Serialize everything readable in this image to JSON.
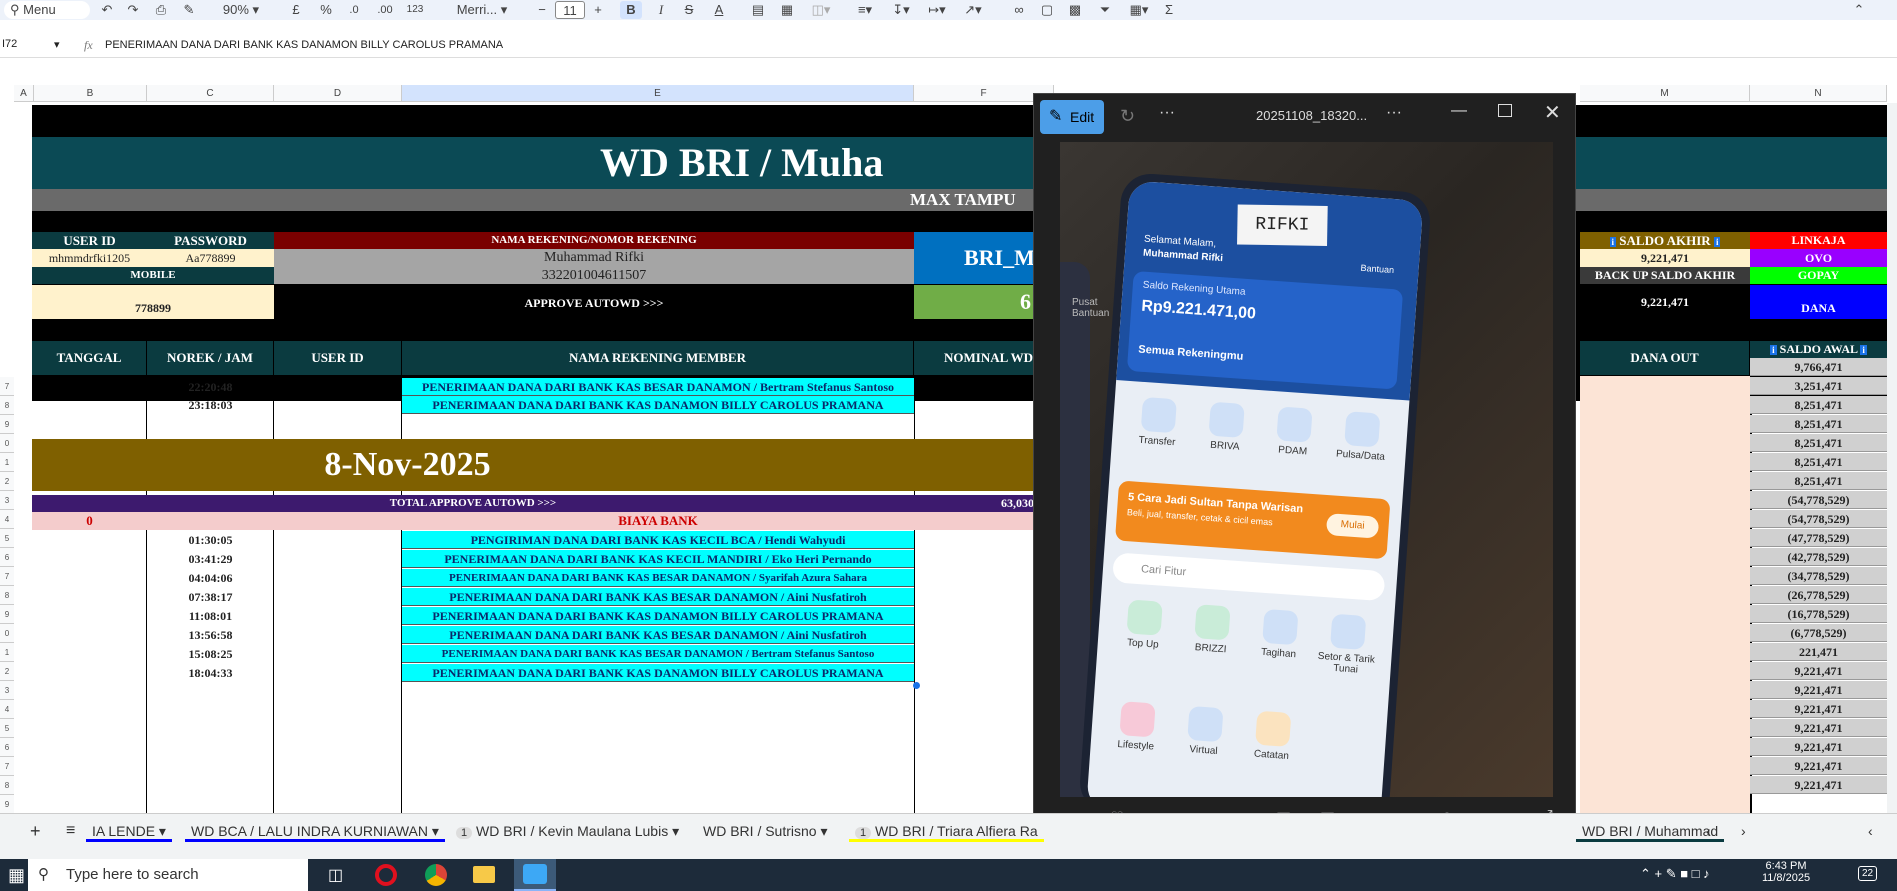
{
  "toolbar": {
    "menu": "Menu",
    "zoom": "90%",
    "currency": "£",
    "percent": "%",
    "dec_less": ".0",
    "dec_more": ".00",
    "num_format": "123",
    "font": "Merri...",
    "font_size": "11"
  },
  "formula_bar": {
    "cell_ref": "I72",
    "fx": "fx",
    "content": "PENERIMAAN DANA DARI BANK KAS DANAMON BILLY CAROLUS PRAMANA"
  },
  "columns": [
    "A",
    "B",
    "C",
    "D",
    "E",
    "F",
    "M",
    "N"
  ],
  "row_numbers": [
    "7",
    "8",
    "9",
    "0",
    "1",
    "2",
    "3",
    "4",
    "5",
    "6",
    "7",
    "8",
    "9",
    "0",
    "1",
    "2",
    "3",
    "4",
    "5",
    "6",
    "7",
    "8",
    "9"
  ],
  "sheet": {
    "title": "WD BRI / Muha",
    "subtitle": "MAX TAMPU",
    "user_id_label": "USER ID",
    "password_label": "PASSWORD",
    "user_id": "mhmmdrfki1205",
    "password": "Aa778899",
    "mobile_label": "MOBILE",
    "mobile": "778899",
    "nama_rek_label": "NAMA REKENING/NOMOR REKENING",
    "nama": "Muhammad Rifki",
    "norek": "332201004611507",
    "approve": "APPROVE AUTOWD >>>",
    "bri_m": "BRI_M",
    "bri_num": "6",
    "saldo_akhir_label": "SALDO AKHIR",
    "saldo_akhir": "9,221,471",
    "backup_label": "BACK UP SALDO AKHIR",
    "backup": "9,221,471",
    "linkaja": "LINKAJA",
    "ovo": "OVO",
    "gopay": "GOPAY",
    "dana": "DANA",
    "headers": {
      "tanggal": "TANGGAL",
      "norek_jam": "NOREK / JAM",
      "user_id": "USER ID",
      "nama_member": "NAMA REKENING MEMBER",
      "nominal": "NOMINAL WD",
      "dana_out": "DANA OUT",
      "saldo_awal": "SALDO AWAL"
    },
    "saldo_awal_first": "9,766,471",
    "date_banner": "8-Nov-2025",
    "total_label": "TOTAL APPROVE AUTOWD >>>",
    "total_value": "63,030",
    "biaya_label": "BIAYA BANK",
    "biaya_count": "0",
    "top_rows": [
      {
        "time": "22:20:48",
        "desc": "PENERIMAAN DANA DARI BANK KAS BESAR DANAMON / Bertram Stefanus Santoso"
      },
      {
        "time": "23:18:03",
        "desc": "PENERIMAAN DANA DARI BANK KAS DANAMON BILLY CAROLUS PRAMANA"
      }
    ],
    "rows": [
      {
        "time": "01:30:05",
        "desc": "PENGIRIMAN DANA DARI BANK KAS KECIL BCA / Hendi Wahyudi"
      },
      {
        "time": "03:41:29",
        "desc": "PENERIMAAN DANA DARI BANK KAS KECIL MANDIRI / Eko Heri Pernando"
      },
      {
        "time": "04:04:06",
        "desc": "PENERIMAAN DANA DARI BANK KAS BESAR DANAMON / Syarifah Azura Sahara"
      },
      {
        "time": "07:38:17",
        "desc": "PENERIMAAN DANA DARI BANK KAS BESAR DANAMON / Aini Nusfatiroh"
      },
      {
        "time": "11:08:01",
        "desc": "PENERIMAAN DANA DARI BANK KAS DANAMON BILLY CAROLUS PRAMANA"
      },
      {
        "time": "13:56:58",
        "desc": "PENERIMAAN DANA DARI BANK KAS BESAR DANAMON / Aini Nusfatiroh"
      },
      {
        "time": "15:08:25",
        "desc": "PENERIMAAN DANA DARI BANK KAS BESAR DANAMON / Bertram Stefanus Santoso"
      },
      {
        "time": "18:04:33",
        "desc": "PENERIMAAN DANA DARI BANK KAS DANAMON BILLY CAROLUS PRAMANA"
      }
    ],
    "saldo_list": [
      "3,251,471",
      "8,251,471",
      "8,251,471",
      "8,251,471",
      "8,251,471",
      "8,251,471",
      "(54,778,529)",
      "(54,778,529)",
      "(47,778,529)",
      "(42,778,529)",
      "(34,778,529)",
      "(26,778,529)",
      "(16,778,529)",
      "(6,778,529)",
      "221,471",
      "9,221,471",
      "9,221,471",
      "9,221,471",
      "9,221,471",
      "9,221,471",
      "9,221,471",
      "9,221,471"
    ]
  },
  "viewer": {
    "edit": "Edit",
    "filename": "20251108_18320...",
    "more": "...",
    "phone": {
      "sticker": "RIFKI",
      "greeting": "Selamat Malam,",
      "name": "Muhammad Rifki",
      "saldo_label": "Saldo Rekening Utama",
      "saldo": "Rp9.221.471,00",
      "semua": "Semua Rekeningmu",
      "menu1": [
        "Transfer",
        "BRIVA",
        "PDAM",
        "Pulsa/Data"
      ],
      "promo": "5 Cara Jadi Sultan Tanpa Warisan",
      "promo_sub": "Beli, jual, transfer, cetak & cicil emas",
      "mulai": "Mulai",
      "search": "Cari Fitur",
      "menu2": [
        "Top Up",
        "BRIZZI",
        "Tagihan",
        "Setor & Tarik Tunai"
      ],
      "menu3": [
        "Lifestyle",
        "Virtual",
        "Catatan"
      ],
      "pusat": "Pusat Bantuan",
      "bantuan": "Bantuan"
    }
  },
  "tabs": [
    "IA LENDE",
    "WD BCA / LALU INDRA KURNIAWAN",
    "WD BRI / Kevin Maulana Lubis",
    "WD BRI / Sutrisno",
    "WD BRI / Triara Alfiera Ra",
    "WD BRI / Muhammad"
  ],
  "tab_badge": "1",
  "taskbar": {
    "search": "Type here to search",
    "time": "6:43 PM",
    "date": "11/8/2025",
    "notif": "22"
  }
}
